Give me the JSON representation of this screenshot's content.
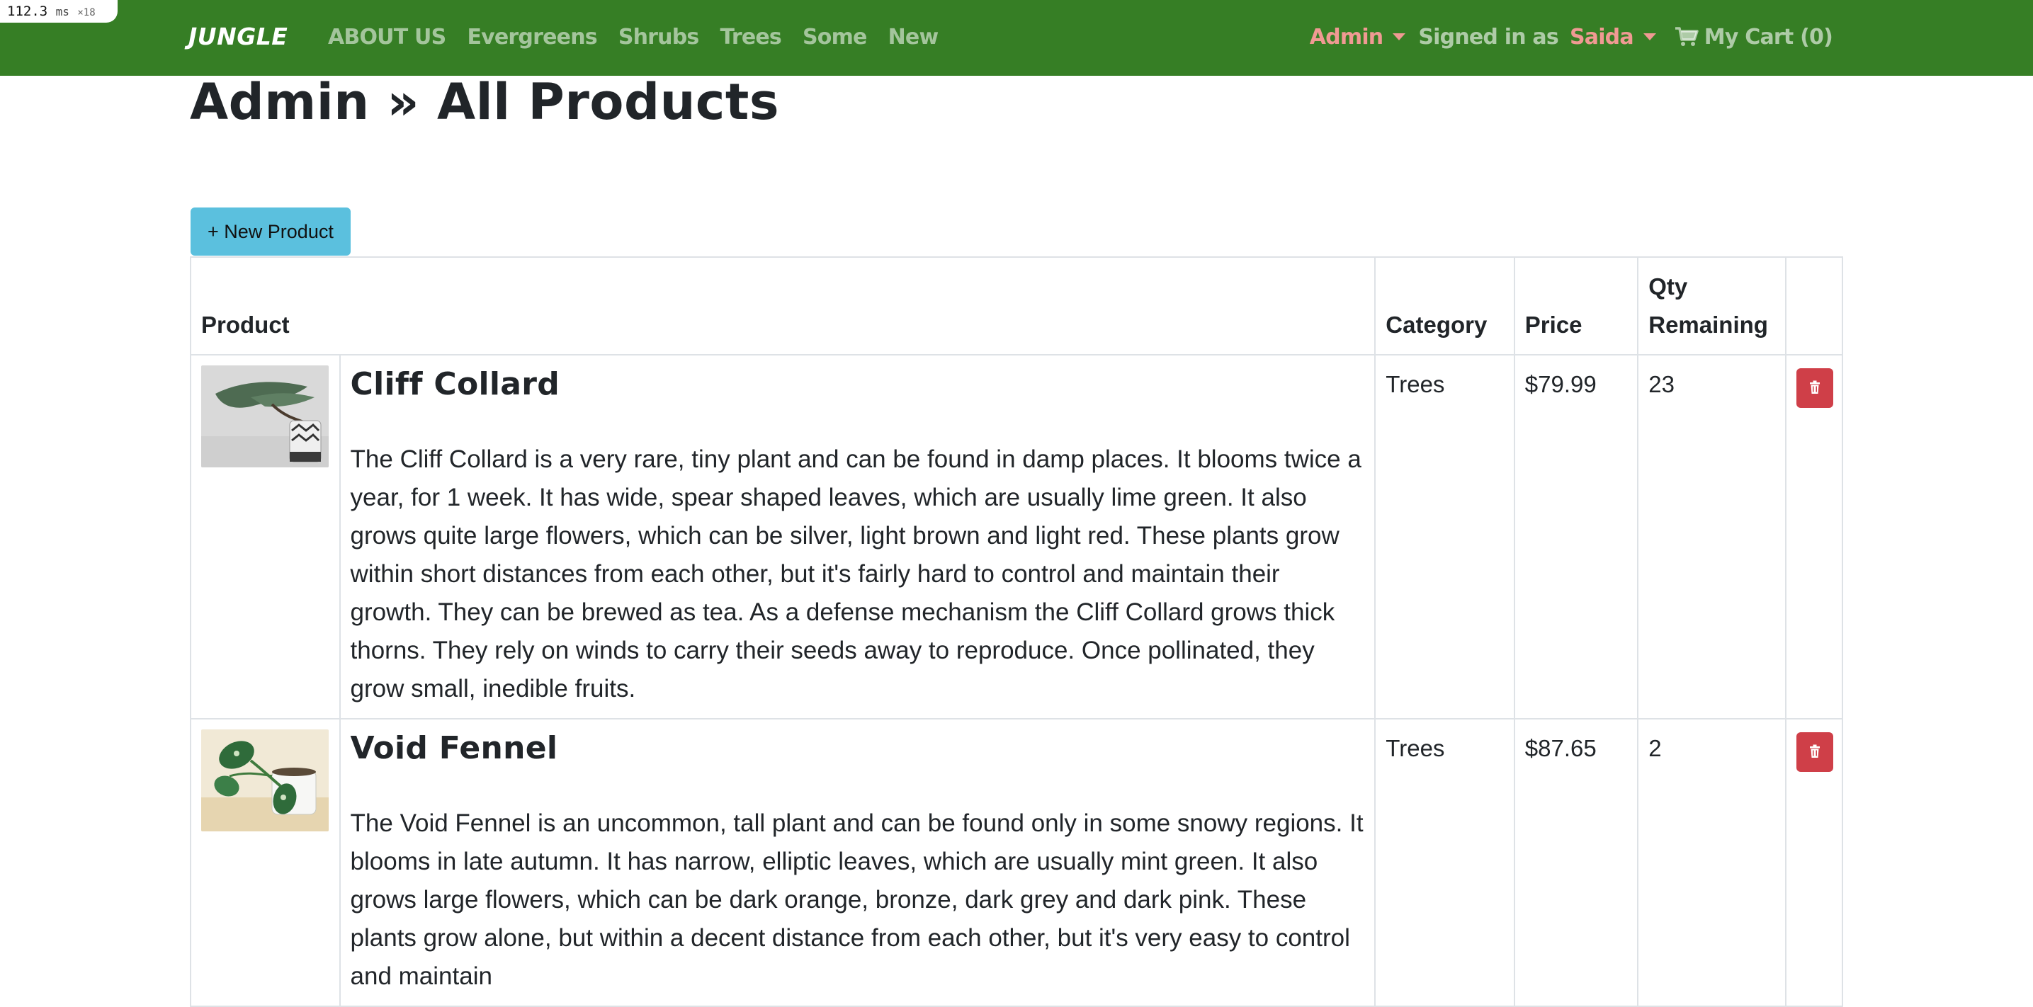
{
  "perf": {
    "value": "112.3",
    "unit": "ms",
    "count": "×18"
  },
  "navbar": {
    "brand": "JUNGLE",
    "links": [
      "ABOUT US",
      "Evergreens",
      "Shrubs",
      "Trees",
      "Some",
      "New"
    ],
    "admin_label": "Admin",
    "signed_in_prefix": "Signed in as",
    "user_name": "Saida",
    "cart_label": "My Cart (0)",
    "cart_icon": "cart-icon",
    "colors": {
      "bg": "#367e25",
      "accent": "#f09a93"
    }
  },
  "page": {
    "title": "Admin » All Products",
    "new_product_label": "+ New Product"
  },
  "table": {
    "headers": {
      "product": "Product",
      "category": "Category",
      "price": "Price",
      "qty": "Qty Remaining"
    },
    "rows": [
      {
        "name": "Cliff Collard",
        "description": "The Cliff Collard is a very rare, tiny plant and can be found in damp places. It blooms twice a year, for 1 week. It has wide, spear shaped leaves, which are usually lime green. It also grows quite large flowers, which can be silver, light brown and light red. These plants grow within short distances from each other, but it's fairly hard to control and maintain their growth. They can be brewed as tea. As a defense mechanism the Cliff Collard grows thick thorns. They rely on winds to carry their seeds away to reproduce. Once pollinated, they grow small, inedible fruits.",
        "category": "Trees",
        "price": "$79.99",
        "qty": "23",
        "image_icon": "bonsai-tree-image"
      },
      {
        "name": "Void Fennel",
        "description": "The Void Fennel is an uncommon, tall plant and can be found only in some snowy regions. It blooms in late autumn. It has narrow, elliptic leaves, which are usually mint green. It also grows large flowers, which can be dark orange, bronze, dark grey and dark pink. These plants grow alone, but within a decent distance from each other, but it's very easy to control and maintain",
        "category": "Trees",
        "price": "$87.65",
        "qty": "2",
        "image_icon": "pothos-plant-image"
      }
    ],
    "delete_icon": "trash-icon",
    "delete_color": "#cf3f48"
  }
}
